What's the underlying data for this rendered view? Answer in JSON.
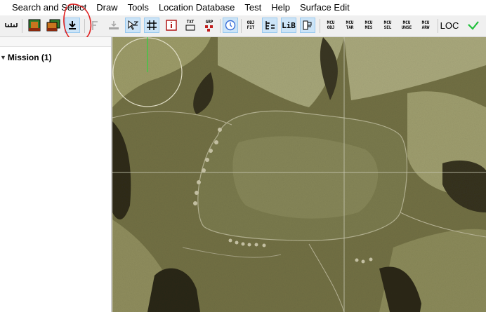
{
  "menu": {
    "items": [
      "Search and Select",
      "Draw",
      "Tools",
      "Location Database",
      "Test",
      "Help",
      "Surface Edit"
    ]
  },
  "toolbar": {
    "obj_fit": [
      "OBJ",
      "FIT"
    ],
    "txt_top": "TXT",
    "grp_top": "GRP",
    "lib_label": "LiB",
    "mcu_obj": [
      "MCU",
      "OBJ"
    ],
    "mcu_tar": [
      "MCU",
      "TAR"
    ],
    "mcu_mes": [
      "MCU",
      "MES"
    ],
    "mcu_sel": [
      "MCU",
      "SEL"
    ],
    "mcu_unse": [
      "MCU",
      "UNSE"
    ],
    "mcu_arw": [
      "MCU",
      "ARW"
    ],
    "loc_label": "LOC",
    "annotation_color": "#e02020",
    "selected_color": "#cce4f7"
  },
  "tree": {
    "mission_label": "Mission (1)"
  },
  "map": {
    "crosshair_color": "#c9c9b4",
    "cursor_color": "#2fd13f"
  }
}
